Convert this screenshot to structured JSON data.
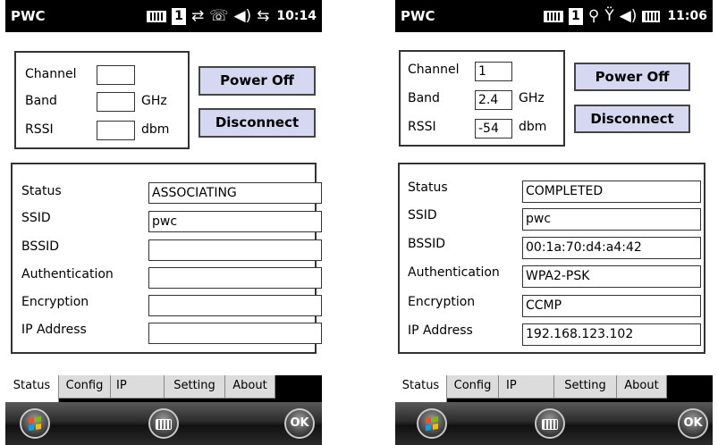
{
  "screens": [
    {
      "title": "PWC",
      "clock": "10:14",
      "sim_number": "1",
      "status_icons": [
        "battery-icon",
        "sim-icon",
        "signal-activity-icon",
        "phone-icon",
        "volume-icon",
        "connection-icon"
      ],
      "labels": {
        "channel": "Channel",
        "band": "Band",
        "rssi": "RSSI",
        "ghz": "GHz",
        "dbm": "dbm",
        "status": "Status",
        "ssid": "SSID",
        "bssid": "BSSID",
        "authentication": "Authentication",
        "encryption": "Encryption",
        "ip_address": "IP Address"
      },
      "values": {
        "channel": "",
        "band": "",
        "rssi": "",
        "status": "ASSOCIATING",
        "ssid": "pwc",
        "bssid": "",
        "authentication": "",
        "encryption": "",
        "ip_address": ""
      },
      "buttons": {
        "power_off": "Power Off",
        "disconnect": "Disconnect"
      },
      "tabs": [
        "Status",
        "Config",
        "IP",
        "Setting",
        "About"
      ],
      "softkeys": {
        "ok": "OK"
      }
    },
    {
      "title": "PWC",
      "clock": "11:06",
      "sim_number": "1",
      "status_icons": [
        "battery-icon",
        "sim-icon",
        "network-icon",
        "no-signal-icon",
        "volume-icon",
        "battery-full-icon"
      ],
      "labels": {
        "channel": "Channel",
        "band": "Band",
        "rssi": "RSSI",
        "ghz": "GHz",
        "dbm": "dbm",
        "status": "Status",
        "ssid": "SSID",
        "bssid": "BSSID",
        "authentication": "Authentication",
        "encryption": "Encryption",
        "ip_address": "IP Address"
      },
      "values": {
        "channel": "1",
        "band": "2.4",
        "rssi": "-54",
        "status": "COMPLETED",
        "ssid": "pwc",
        "bssid": "00:1a:70:d4:a4:42",
        "authentication": "WPA2-PSK",
        "encryption": "CCMP",
        "ip_address": "192.168.123.102"
      },
      "buttons": {
        "power_off": "Power Off",
        "disconnect": "Disconnect"
      },
      "tabs": [
        "Status",
        "Config",
        "IP",
        "Setting",
        "About"
      ],
      "softkeys": {
        "ok": "OK"
      }
    }
  ],
  "colors": {
    "button_bg": "#d6d8f2",
    "title_bar": "#000000",
    "tab_bg": "#dcdcdc"
  }
}
